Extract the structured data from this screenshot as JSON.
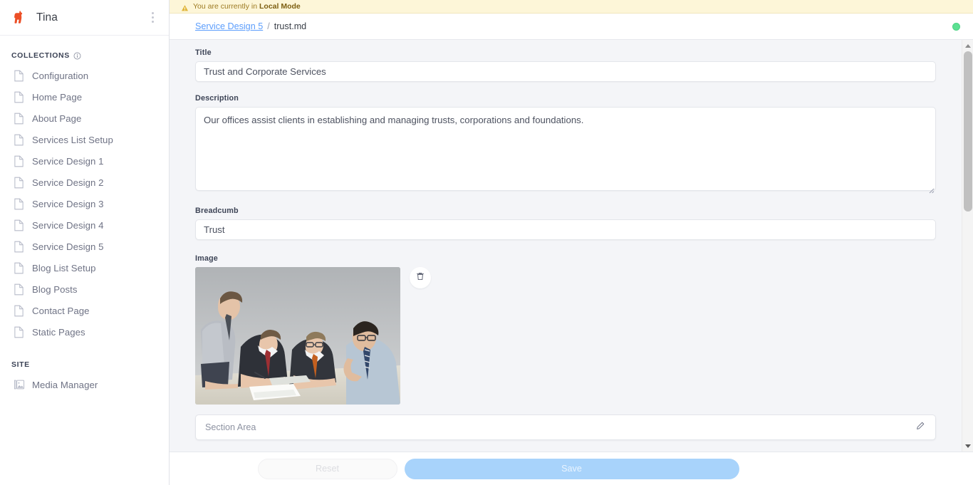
{
  "sidebar": {
    "brand": "Tina",
    "logo_icon": "llama-logo-icon",
    "logo_color": "#ec4f27",
    "menu_icon": "kebab-menu-icon",
    "collections_heading": "COLLECTIONS",
    "collections_info_icon": "info-icon",
    "site_heading": "SITE",
    "collections": [
      {
        "label": "Configuration",
        "icon": "file-icon"
      },
      {
        "label": "Home Page",
        "icon": "file-icon"
      },
      {
        "label": "About Page",
        "icon": "file-icon"
      },
      {
        "label": "Services List Setup",
        "icon": "file-icon"
      },
      {
        "label": "Service Design 1",
        "icon": "file-icon"
      },
      {
        "label": "Service Design 2",
        "icon": "file-icon"
      },
      {
        "label": "Service Design 3",
        "icon": "file-icon"
      },
      {
        "label": "Service Design 4",
        "icon": "file-icon"
      },
      {
        "label": "Service Design 5",
        "icon": "file-icon"
      },
      {
        "label": "Blog List Setup",
        "icon": "file-icon"
      },
      {
        "label": "Blog Posts",
        "icon": "file-icon"
      },
      {
        "label": "Contact Page",
        "icon": "file-icon"
      },
      {
        "label": "Static Pages",
        "icon": "file-icon"
      }
    ],
    "site": [
      {
        "label": "Media Manager",
        "icon": "media-image-icon"
      }
    ]
  },
  "notice": {
    "icon": "warning-triangle-icon",
    "text_prefix": "You are currently in ",
    "text_strong": "Local Mode",
    "background": "#fdf6d8",
    "text_color": "#9d7a22"
  },
  "breadcrumb": {
    "parent": "Service Design 5",
    "separator": "/",
    "current": "trust.md",
    "link_color": "#5b9dfc",
    "status_dot_color": "#5ce092",
    "status_dot_name": "connection-status-dot"
  },
  "form": {
    "title": {
      "label": "Title",
      "value": "Trust and Corporate Services",
      "placeholder": ""
    },
    "description": {
      "label": "Description",
      "value": "Our offices assist clients in establishing and managing trusts, corporations and foundations.",
      "placeholder": ""
    },
    "breadcumb": {
      "label": "Breadcumb",
      "value": "Trust",
      "placeholder": ""
    },
    "image": {
      "label": "Image",
      "alt": "Four business men in suits reviewing documents at a conference table",
      "delete_icon": "trash-icon"
    },
    "section_area": {
      "label": "Section Area",
      "edit_icon": "pencil-icon"
    }
  },
  "footer": {
    "reset_label": "Reset",
    "save_label": "Save",
    "save_color": "#a8d3fb"
  },
  "scrollbar": {
    "up_icon": "chevron-up-icon",
    "down_icon": "chevron-down-icon"
  }
}
